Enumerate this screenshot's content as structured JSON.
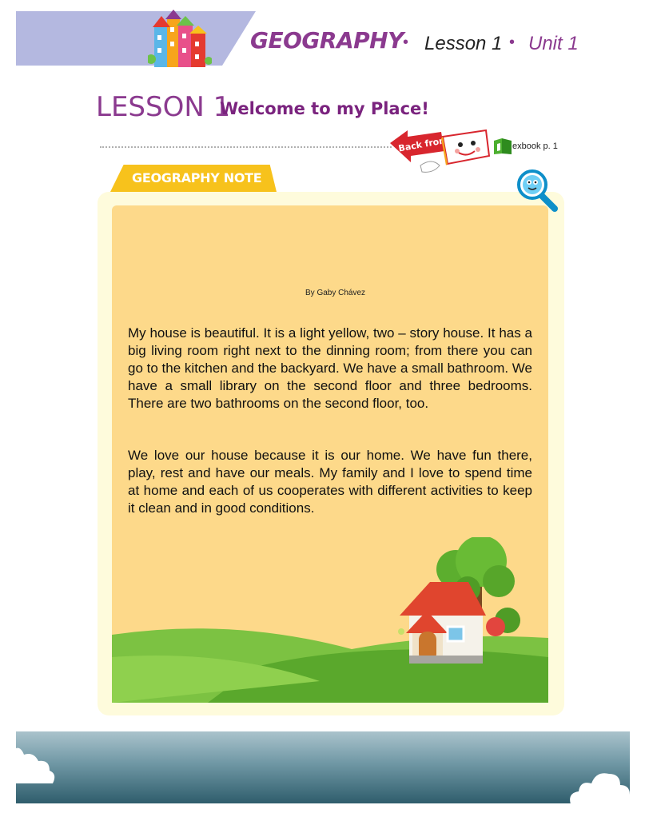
{
  "header": {
    "subject": "GEOGRAPHY",
    "separator": "•",
    "lesson": "Lesson 1",
    "unit": "Unit 1"
  },
  "title": {
    "lesson_number": "LESSON 1",
    "lesson_title": "Welcome to my Place!"
  },
  "back_from": {
    "label": "Back from",
    "textbook_ref": "exbook p. 1"
  },
  "note": {
    "tab_label": "GEOGRAPHY NOTE",
    "author": "By Gaby Chávez",
    "paragraphs": [
      "My house is beautiful. It is a light yellow, two – story house. It has a big living room right next to the dinning room; from there you can go to the kitchen and the backyard. We have a small bathroom. We have a small library on the second floor and three bedrooms. There are two bathrooms on the second floor, too.",
      "We love our house because it is our home. We have fun there, play, rest and have our meals. My family and I love to spend time at home and each of us cooperates with different activities to keep it clean and in good conditions."
    ]
  },
  "colors": {
    "brand_purple": "#8b3a8f",
    "tab_yellow": "#f7c21c",
    "card_fill": "#fdd98a",
    "card_border": "#fefbdc",
    "header_band": "#b4b8e0"
  },
  "icons": [
    "colorful-houses-illustration",
    "back-from-arrow-book-icon",
    "textbook-icon",
    "magnifier-icon",
    "house-tree-illustration",
    "cloud-icon"
  ]
}
